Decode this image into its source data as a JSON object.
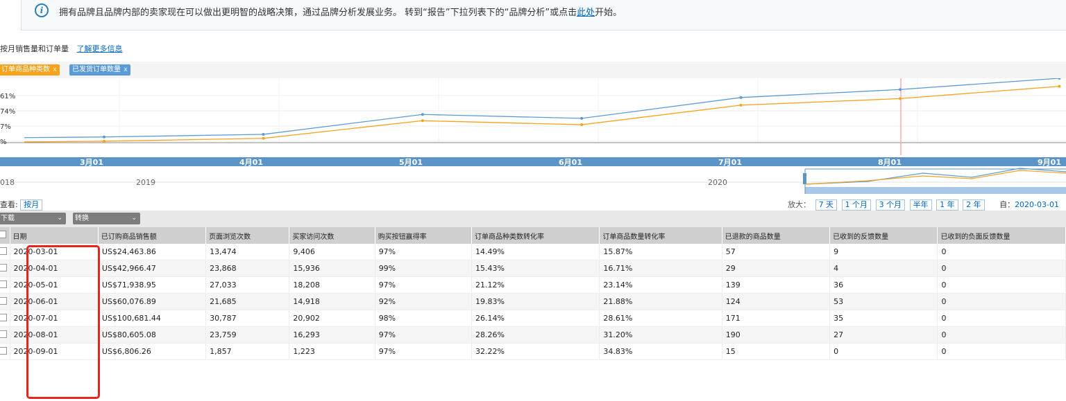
{
  "info": {
    "text": "拥有品牌且品牌内部的卖家现在可以做出更明智的战略决策，通过品牌分析发展业务。 转到“报告”下拉列表下的“品牌分析”或点击",
    "link": "此处",
    "suffix": "开始。"
  },
  "chart_title": "按月销售量和订单量",
  "learn_more": "了解更多信息",
  "chips": [
    "订单商品种类数",
    "已发货订单数量"
  ],
  "chart_data": {
    "type": "line",
    "categories": [
      "2020-03-01",
      "2020-04-01",
      "2020-05-01",
      "2020-06-01",
      "2020-07-01",
      "2020-08-01",
      "2020-09-01"
    ],
    "series": [
      {
        "name": "订单商品种类数",
        "color": "#f7a21b",
        "values": [
          14.49,
          15.43,
          21.12,
          19.83,
          26.14,
          28.26,
          32.22
        ]
      },
      {
        "name": "已发货订单数量",
        "color": "#5b9bd5",
        "values": [
          15.87,
          16.71,
          23.14,
          21.88,
          28.61,
          31.2,
          34.83
        ]
      }
    ],
    "y_tick_labels": [
      "61%",
      "74%",
      "7%",
      "%"
    ],
    "x_tick_labels": [
      "3月01",
      "4月01",
      "5月01",
      "6月01",
      "7月01",
      "8月01",
      "9月01"
    ],
    "navigator_labels": [
      "018",
      "2019",
      "2020"
    ]
  },
  "view": {
    "label": "查看:",
    "by_month": "按月"
  },
  "zoom": {
    "label": "放大：",
    "options": [
      "7 天",
      "1 个月",
      "3 个月",
      "半年",
      "1 年",
      "2 年"
    ],
    "from_label": "自：",
    "from_value": "2020-03-01"
  },
  "toolbar": {
    "download": "下载",
    "convert": "转换"
  },
  "columns": [
    "日期",
    "已订购商品销售额",
    "页面浏览次数",
    "买家访问次数",
    "购买按钮赢得率",
    "订单商品种类数转化率",
    "订单商品数量转化率",
    "已退款的商品数量",
    "已收到的反馈数量",
    "已收到的负面反馈数量"
  ],
  "rows": [
    [
      "2020-03-01",
      "US$24,463.86",
      "13,474",
      "9,406",
      "97%",
      "14.49%",
      "15.87%",
      "57",
      "9",
      "0"
    ],
    [
      "2020-04-01",
      "US$42,966.47",
      "23,868",
      "15,936",
      "99%",
      "15.43%",
      "16.71%",
      "29",
      "4",
      "0"
    ],
    [
      "2020-05-01",
      "US$71,938.95",
      "27,033",
      "18,208",
      "97%",
      "21.12%",
      "23.14%",
      "139",
      "36",
      "0"
    ],
    [
      "2020-06-01",
      "US$60,076.89",
      "21,685",
      "14,918",
      "92%",
      "19.83%",
      "21.88%",
      "124",
      "53",
      "0"
    ],
    [
      "2020-07-01",
      "US$100,681.44",
      "30,787",
      "20,902",
      "98%",
      "26.14%",
      "28.61%",
      "171",
      "35",
      "0"
    ],
    [
      "2020-08-01",
      "US$80,605.08",
      "23,759",
      "16,293",
      "97%",
      "28.26%",
      "31.20%",
      "190",
      "27",
      "0"
    ],
    [
      "2020-09-01",
      "US$6,806.26",
      "1,857",
      "1,223",
      "97%",
      "32.22%",
      "34.83%",
      "15",
      "0",
      "0"
    ]
  ]
}
